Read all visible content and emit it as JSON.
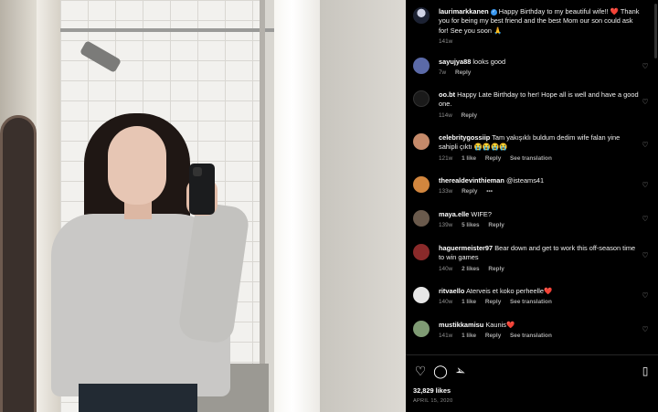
{
  "post": {
    "caption": {
      "username": "laurimarkkanen",
      "text": "Happy Birthday to my beautiful wife!! ❤️ Thank you for being my best friend and the best Mom our son could ask for! See you soon 🙏",
      "time": "141w"
    },
    "likes": "32,829 likes",
    "date": "APRIL 15, 2020"
  },
  "comments": [
    {
      "username": "sayujya88",
      "text": "looks good",
      "time": "7w",
      "likes": "",
      "reply": "Reply",
      "translate": "",
      "avatar_color": "#5b6aa8"
    },
    {
      "username": "oo.bt",
      "text": "Happy Late Birthday to her! Hope all is well and have a good one.",
      "time": "114w",
      "likes": "",
      "reply": "Reply",
      "translate": "",
      "avatar_color": "#1a1a1a"
    },
    {
      "username": "celebritygossiip",
      "text": "Tam yakışıklı buldum dedim wife falan yine sahipli çıktı 😭😭😭😭",
      "time": "121w",
      "likes": "1 like",
      "reply": "Reply",
      "translate": "See translation",
      "avatar_color": "#c58a6a"
    },
    {
      "username": "therealdevinthieman",
      "text": "@isteams41",
      "time": "133w",
      "likes": "",
      "reply": "Reply",
      "translate": "",
      "more": "•••",
      "avatar_color": "#d2863e"
    },
    {
      "username": "maya.elle",
      "text": "WIFE?",
      "time": "139w",
      "likes": "5 likes",
      "reply": "Reply",
      "translate": "",
      "avatar_color": "#6a5a4c"
    },
    {
      "username": "haguermeister97",
      "text": "Bear down and get to work this off-season time to win games",
      "time": "140w",
      "likes": "2 likes",
      "reply": "Reply",
      "translate": "",
      "avatar_color": "#8a2a2a"
    },
    {
      "username": "ritvaello",
      "text": "Aterveis et koko perheelle❤️",
      "time": "140w",
      "likes": "1 like",
      "reply": "Reply",
      "translate": "See translation",
      "avatar_color": "#e6e6e6"
    },
    {
      "username": "mustikkamisu",
      "text": "Kaunis❤️",
      "time": "141w",
      "likes": "1 like",
      "reply": "Reply",
      "translate": "See translation",
      "avatar_color": "#7f9b74"
    }
  ],
  "icons": {
    "like": "heart-icon",
    "comment": "comment-icon",
    "share": "share-icon",
    "save": "bookmark-icon"
  }
}
